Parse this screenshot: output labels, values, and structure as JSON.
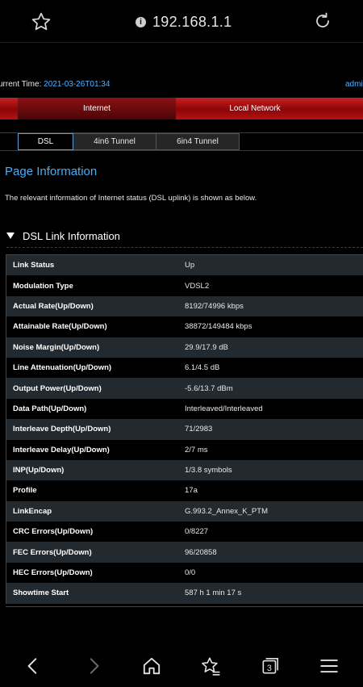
{
  "browser": {
    "url": "192.168.1.1",
    "icons": {
      "favorite": "star-icon",
      "security": "info-icon",
      "reload": "reload-icon"
    }
  },
  "header": {
    "time_label": "urrent Time: ",
    "time_value": "2021-03-26T01:34",
    "user_link": "admi"
  },
  "nav": {
    "internet": "Internet",
    "local_network": "Local Network"
  },
  "tabs": [
    "DSL",
    "4in6 Tunnel",
    "6in4 Tunnel"
  ],
  "page": {
    "title": "Page Information",
    "description": "The relevant information of Internet status (DSL uplink) is shown as below."
  },
  "section": {
    "title": "DSL Link Information"
  },
  "table": [
    {
      "label": "Link Status",
      "value": "Up"
    },
    {
      "label": "Modulation Type",
      "value": "VDSL2"
    },
    {
      "label": "Actual Rate(Up/Down)",
      "value": "8192/74996 kbps"
    },
    {
      "label": "Attainable Rate(Up/Down)",
      "value": "38872/149484 kbps"
    },
    {
      "label": "Noise Margin(Up/Down)",
      "value": "29.9/17.9 dB"
    },
    {
      "label": "Line Attenuation(Up/Down)",
      "value": "6.1/4.5 dB"
    },
    {
      "label": "Output Power(Up/Down)",
      "value": "-5.6/13.7 dBm"
    },
    {
      "label": "Data Path(Up/Down)",
      "value": "Interleaved/Interleaved"
    },
    {
      "label": "Interleave Depth(Up/Down)",
      "value": "71/2983"
    },
    {
      "label": "Interleave Delay(Up/Down)",
      "value": "2/7 ms"
    },
    {
      "label": "INP(Up/Down)",
      "value": "1/3.8 symbols"
    },
    {
      "label": "Profile",
      "value": "17a"
    },
    {
      "label": "LinkEncap",
      "value": "G.993.2_Annex_K_PTM"
    },
    {
      "label": "CRC Errors(Up/Down)",
      "value": "0/8227"
    },
    {
      "label": "FEC Errors(Up/Down)",
      "value": "96/20858"
    },
    {
      "label": "HEC Errors(Up/Down)",
      "value": "0/0"
    },
    {
      "label": "Showtime Start",
      "value": "587 h 1 min 17 s"
    }
  ],
  "bottom_bar": {
    "tab_count": "3",
    "icons": [
      "back-icon",
      "forward-icon",
      "home-icon",
      "bookmarks-icon",
      "tabs-icon",
      "menu-icon"
    ]
  },
  "colors": {
    "accent_blue": "#46aef5",
    "nav_red": "#c81f22",
    "row_alt": "#222a30"
  }
}
